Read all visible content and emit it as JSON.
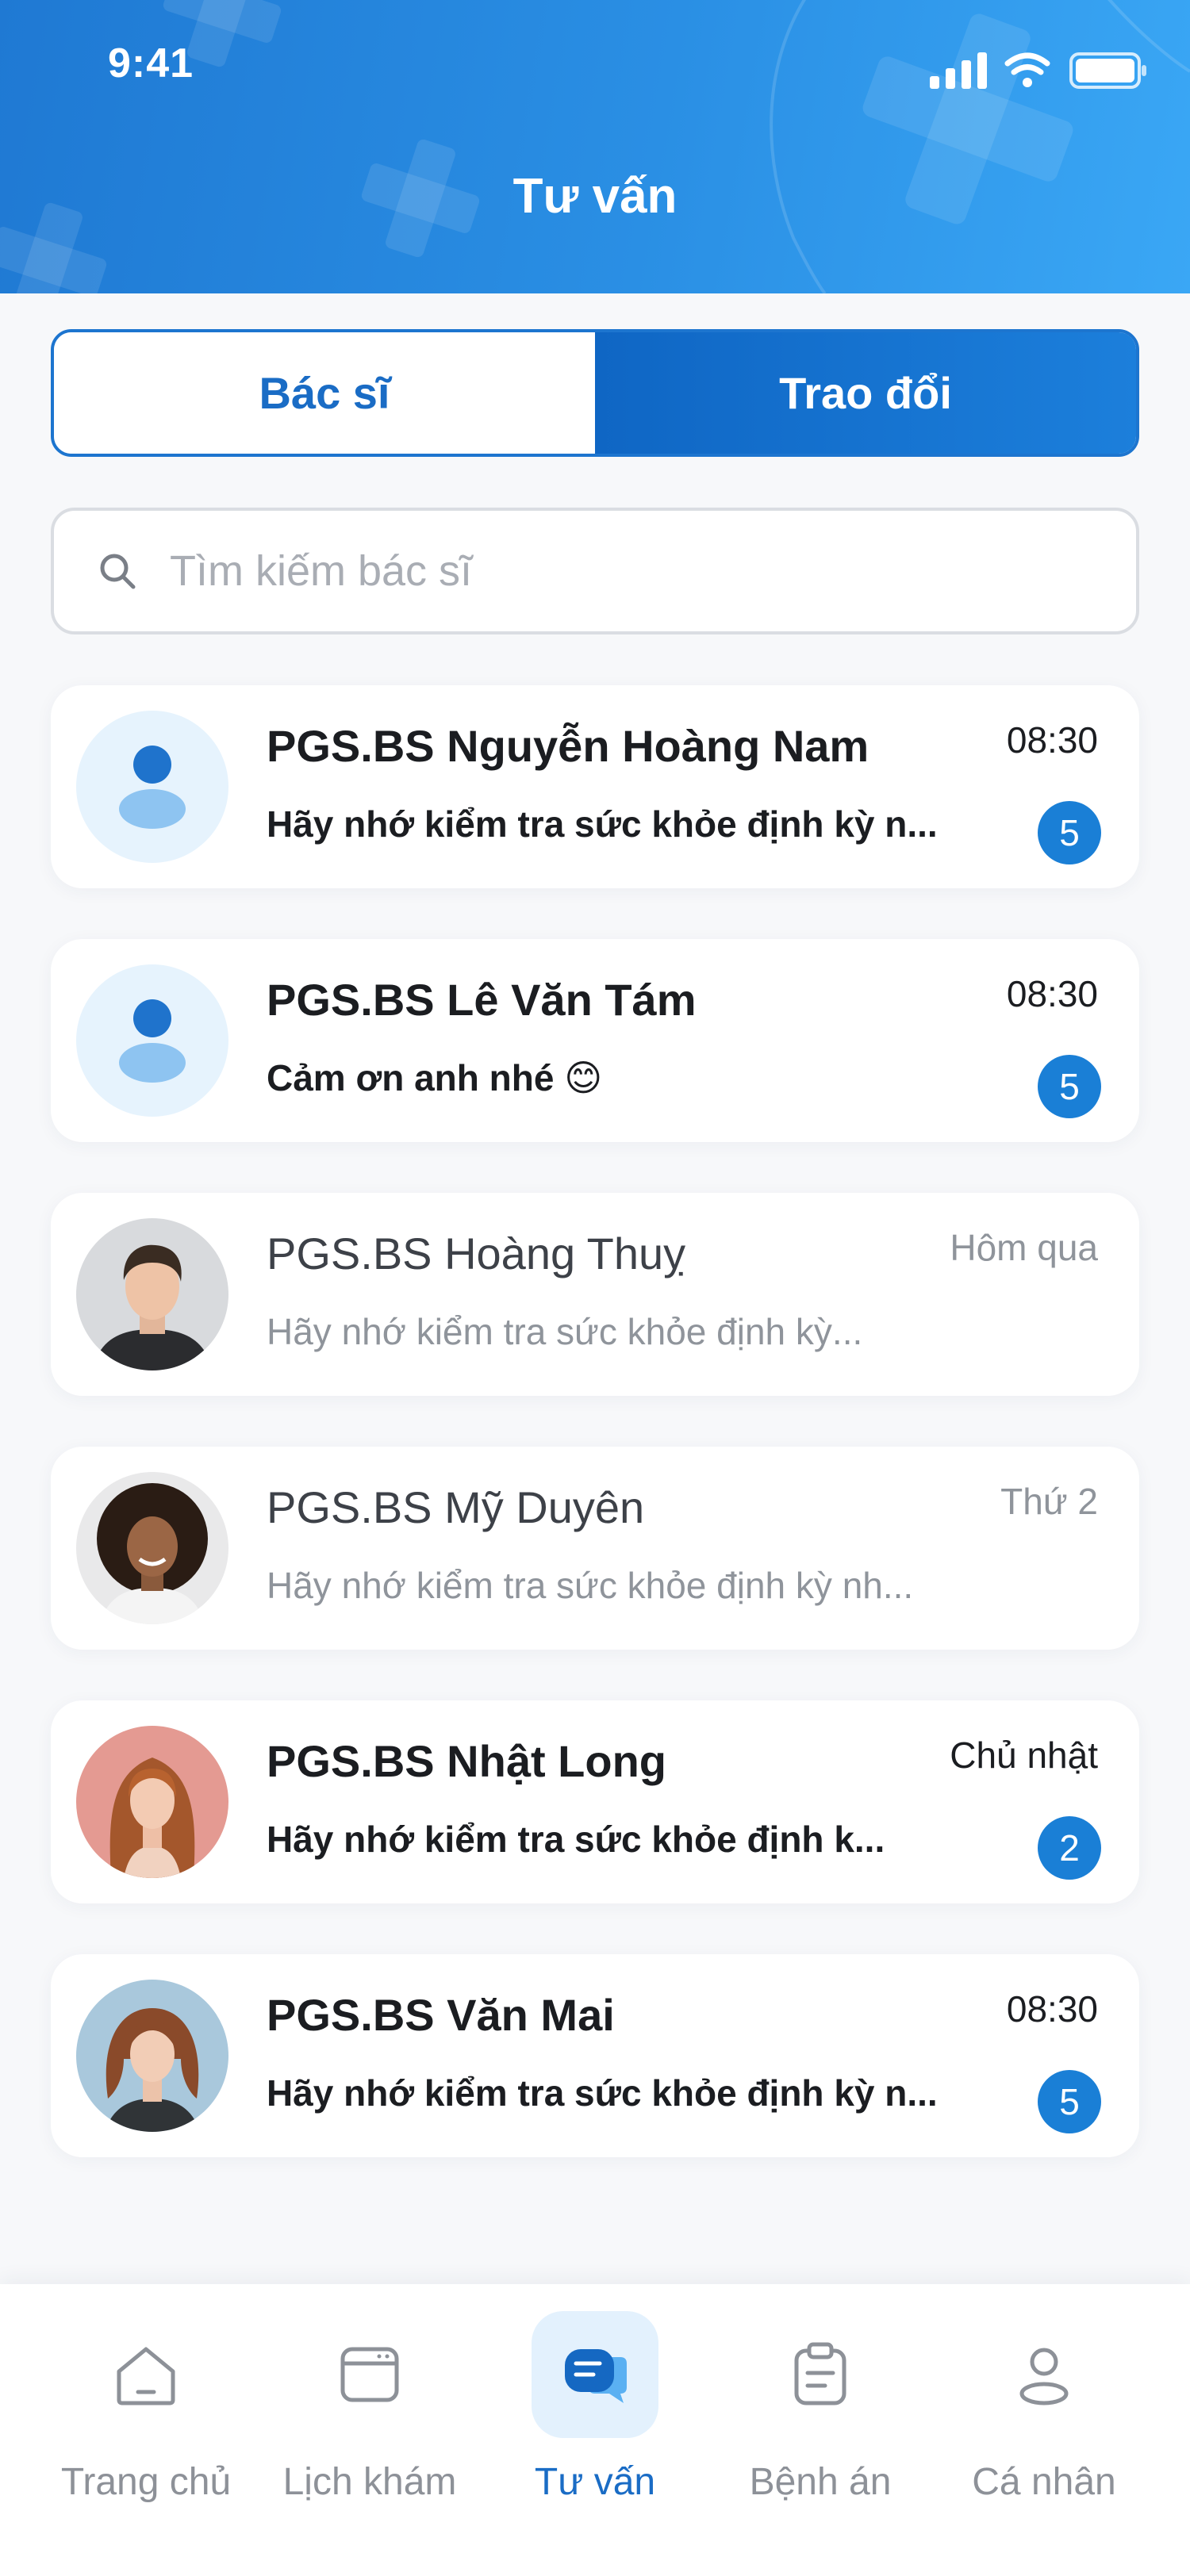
{
  "status_bar": {
    "time": "9:41"
  },
  "header": {
    "title": "Tư vấn"
  },
  "tabs": [
    {
      "label": "Bác sĩ",
      "active": false
    },
    {
      "label": "Trao đổi",
      "active": true
    }
  ],
  "search": {
    "placeholder": "Tìm kiếm bác sĩ",
    "value": ""
  },
  "conversations": [
    {
      "name": "PGS.BS Nguyễn Hoàng Nam",
      "message": "Hãy nhớ kiểm tra sức khỏe định kỳ n...",
      "time": "08:30",
      "unread": "5",
      "avatar": "placeholder"
    },
    {
      "name": "PGS.BS Lê Văn Tám",
      "message": "Cảm ơn anh nhé 😊",
      "time": "08:30",
      "unread": "5",
      "avatar": "placeholder"
    },
    {
      "name": "PGS.BS Hoàng Thuỵ",
      "message": "Hãy nhớ kiểm tra sức khỏe định kỳ...",
      "time": "Hôm qua",
      "unread": "",
      "avatar": "photo-man"
    },
    {
      "name": "PGS.BS Mỹ Duyên",
      "message": "Hãy nhớ kiểm tra sức khỏe định kỳ nh...",
      "time": "Thứ 2",
      "unread": "",
      "avatar": "photo-woman-curly"
    },
    {
      "name": "PGS.BS Nhật Long",
      "message": "Hãy nhớ kiểm tra sức khỏe định k...",
      "time": "Chủ nhật",
      "unread": "2",
      "avatar": "photo-woman-redhair"
    },
    {
      "name": "PGS.BS Văn Mai",
      "message": "Hãy nhớ kiểm tra sức khỏe định kỳ n...",
      "time": "08:30",
      "unread": "5",
      "avatar": "photo-woman-bob"
    }
  ],
  "bottom_nav": [
    {
      "label": "Trang chủ",
      "icon": "home-icon",
      "active": false
    },
    {
      "label": "Lịch khám",
      "icon": "calendar-icon",
      "active": false
    },
    {
      "label": "Tư vấn",
      "icon": "chat-icon",
      "active": true
    },
    {
      "label": "Bệnh án",
      "icon": "clipboard-icon",
      "active": false
    },
    {
      "label": "Cá nhân",
      "icon": "user-icon",
      "active": false
    }
  ],
  "colors": {
    "primary": "#1a7fd6",
    "header_gradient_start": "#1f79d3",
    "header_gradient_end": "#3aa7f5",
    "badge": "#1a7fd6",
    "nav_active": "#1a6cc5",
    "nav_inactive": "#8d9198"
  }
}
